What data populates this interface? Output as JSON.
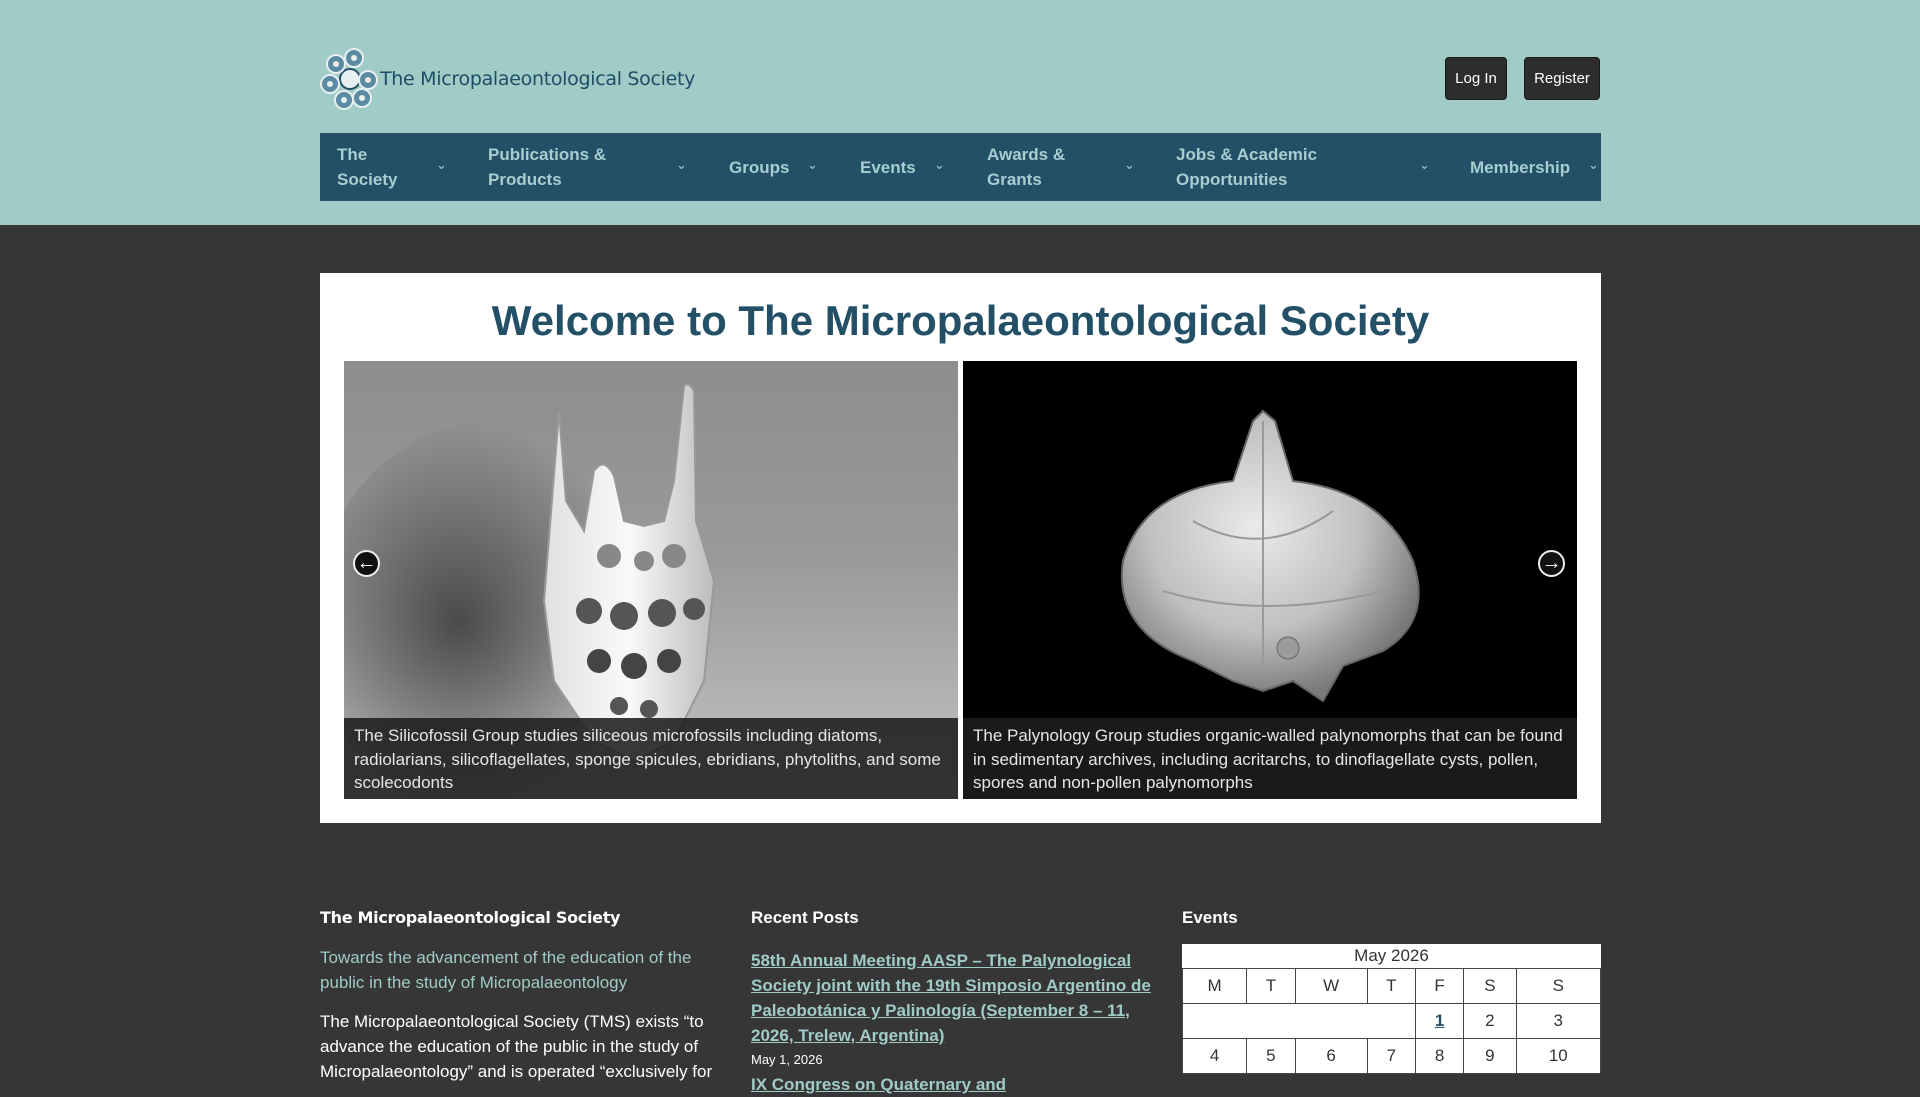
{
  "header": {
    "site_name": "The Micropalaeontological Society",
    "login_label": "Log In",
    "register_label": "Register"
  },
  "nav": {
    "items": [
      {
        "label_line1": "The",
        "label_line2": "Society"
      },
      {
        "label_line1": "Publications &",
        "label_line2": "Products"
      },
      {
        "label_line1": "Groups",
        "label_line2": ""
      },
      {
        "label_line1": "Events",
        "label_line2": ""
      },
      {
        "label_line1": "Awards &",
        "label_line2": "Grants"
      },
      {
        "label_line1": "Jobs & Academic",
        "label_line2": "Opportunities"
      },
      {
        "label_line1": "Membership",
        "label_line2": ""
      }
    ],
    "chevron_icon": "chevron-down-icon"
  },
  "hero": {
    "title": "Welcome to The Micropalaeontological Society",
    "slides": [
      {
        "caption": "The Silicofossil Group studies siliceous microfossils including diatoms, radiolarians, silicoflagellates, sponge spicules, ebridians, phytoliths, and some scolecodonts"
      },
      {
        "caption": "The Palynology Group studies organic-walled palynomorphs that can be found in sedimentary archives, including acritarchs, to dinoflagellate cysts, pollen, spores and non-pollen palynomorphs"
      }
    ]
  },
  "footer": {
    "about": {
      "title": "The Micropalaeontological Society",
      "tagline": "Towards the advancement of the education of the public in the study of Micropalaeontology",
      "text": "The Micropalaeontological Society (TMS) exists “to advance the education of the public in the study of Micropalaeontology” and is operated “exclusively for"
    },
    "recent_posts": {
      "title": "Recent Posts",
      "post1_title": "58th Annual Meeting AASP – The Palynological Society joint with the 19th Simposio Argentino de Paleobotánica y Palinología (September 8 – 11, 2026, Trelew, Argentina)",
      "post1_date": "May 1, 2026",
      "post2_title": "IX Congress on Quaternary and"
    },
    "events": {
      "title": "Events",
      "month": "May 2026",
      "weekdays": [
        "M",
        "T",
        "W",
        "T",
        "F",
        "S",
        "S"
      ],
      "week1": [
        "",
        "",
        "",
        "",
        "1",
        "2",
        "3"
      ],
      "week2": [
        "4",
        "5",
        "6",
        "7",
        "8",
        "9",
        "10"
      ],
      "linked_day": "1"
    }
  }
}
